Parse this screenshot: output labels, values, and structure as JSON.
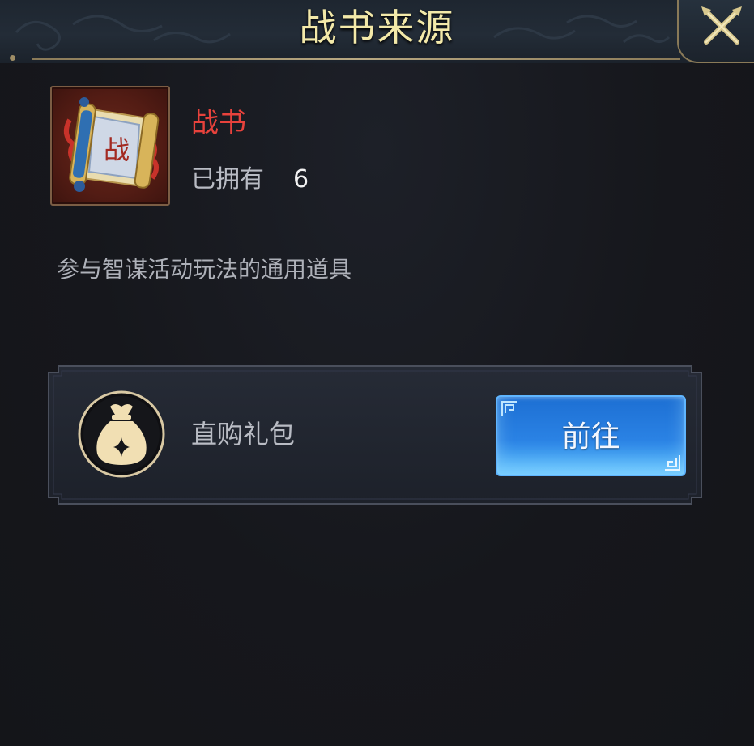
{
  "dialog": {
    "title": "战书来源",
    "close_icon": "close-x-icon"
  },
  "item": {
    "icon": "scroll-icon",
    "icon_glyph": "战",
    "name": "战书",
    "owned_label": "已拥有",
    "owned_count": "6",
    "description": "参与智谋活动玩法的通用道具"
  },
  "sources": [
    {
      "icon": "money-bag-icon",
      "label": "直购礼包",
      "button_label": "前往"
    }
  ],
  "colors": {
    "title": "#f3e9a9",
    "item_name": "#e8423c",
    "text_muted": "#b9bcc4",
    "button": "#2a82e4",
    "frame_gold": "#8a7a58"
  }
}
